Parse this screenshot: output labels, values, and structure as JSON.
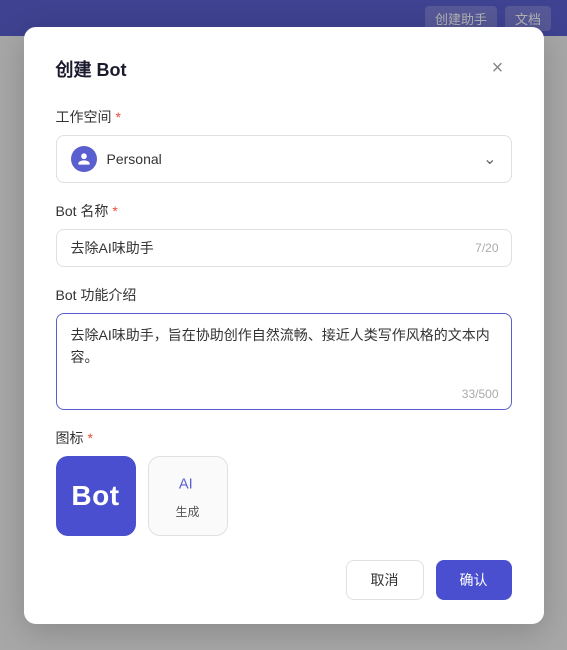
{
  "topbar": {
    "btn1": "创建助手",
    "btn2": "文档"
  },
  "modal": {
    "title": "创建 Bot",
    "close_label": "×",
    "workspace_label": "工作空间",
    "workspace_required": true,
    "workspace_value": "Personal",
    "workspace_icon": "P",
    "bot_name_label": "Bot 名称",
    "bot_name_required": true,
    "bot_name_value": "去除AI味助手",
    "bot_name_counter": "7/20",
    "bot_intro_label": "Bot 功能介绍",
    "bot_intro_value": "去除AI味助手，旨在协助创作自然流畅、接近人类写作风格的文本内容。",
    "bot_intro_counter": "33/500",
    "icon_label": "图标",
    "icon_required": true,
    "icon_preview_text": "Bot",
    "icon_generate_label": "生成",
    "cancel_btn": "取消",
    "confirm_btn": "确认"
  }
}
